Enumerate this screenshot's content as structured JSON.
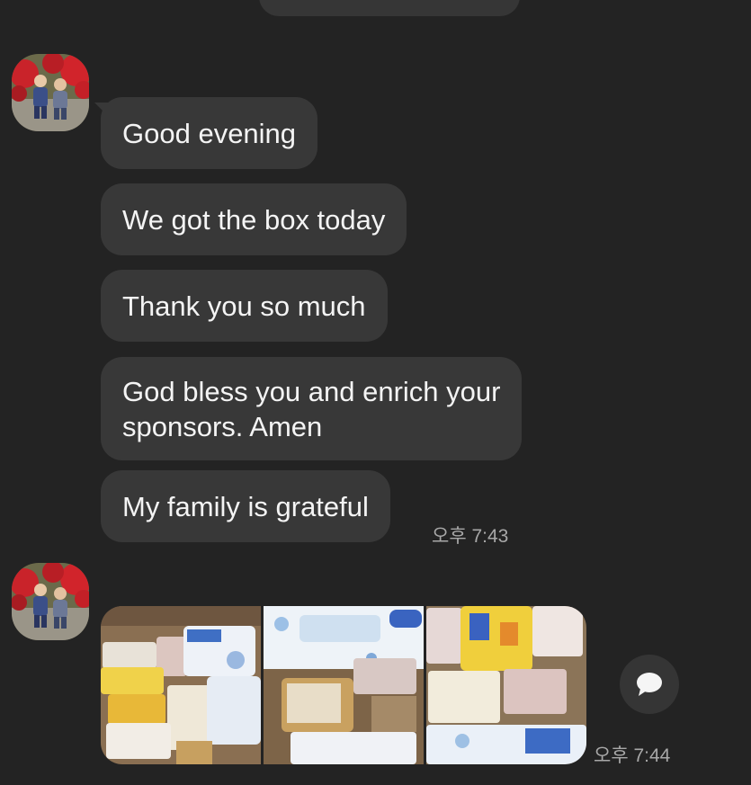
{
  "conversation": {
    "first_group": {
      "messages": [
        {
          "text": "Good evening"
        },
        {
          "text": "We got the box today"
        },
        {
          "text": "Thank you so much"
        },
        {
          "text": "God bless you and enrich your"
        },
        {
          "text": "sponsors. Amen"
        },
        {
          "text": "My family is grateful"
        }
      ],
      "timestamp": "오후 7:43"
    },
    "second_group": {
      "photos_count": 3,
      "timestamp": "오후 7:44"
    }
  },
  "icons": {
    "avatar": "contact-avatar-photo",
    "share": "speech-bubble-icon"
  },
  "colors": {
    "background": "#232323",
    "bubble": "#383838",
    "text": "#f4f4f4",
    "timestamp": "#a8a8a8"
  }
}
